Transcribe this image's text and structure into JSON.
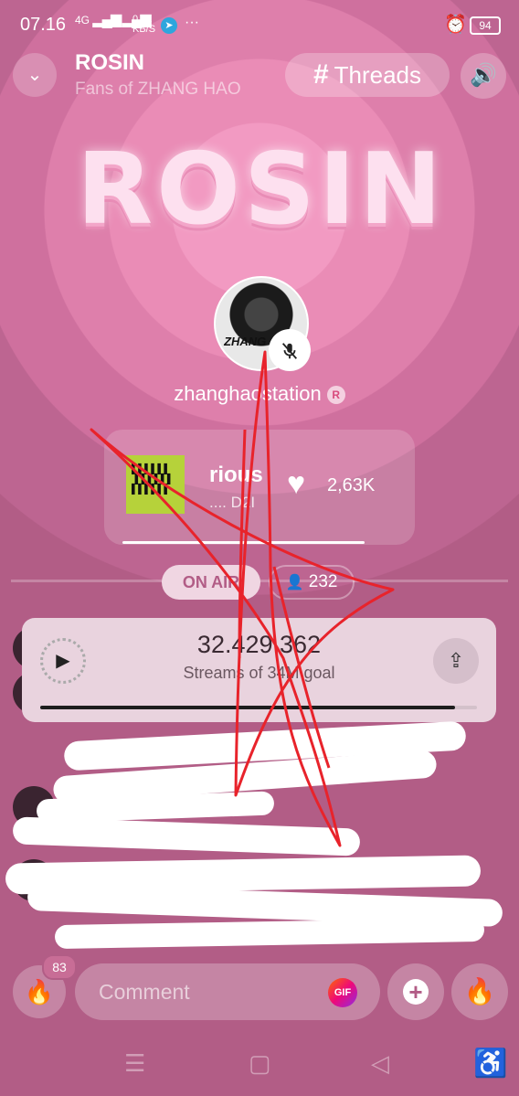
{
  "status_bar": {
    "time": "07.16",
    "network": "4G",
    "speed_value": "0.21",
    "speed_unit": "KB/S",
    "dots": "···",
    "battery": "94"
  },
  "header": {
    "title": "ROSIN",
    "subtitle": "Fans of ZHANG HAO",
    "threads_label": "Threads"
  },
  "logo_text": "ROSIN",
  "host": {
    "avatar_text": "ZHANG STAT",
    "name": "zhanghaostation",
    "badge": "R"
  },
  "now_playing": {
    "title": "rious",
    "artist": ".... D2I",
    "likes": "2,63K",
    "progress": 0.78
  },
  "room": {
    "on_air_label": "ON AIR",
    "listeners": "232"
  },
  "streams": {
    "count": "32.429.362",
    "goal_label": "Streams of 34M goal",
    "progress": 0.95
  },
  "bottom": {
    "fire_count": "83",
    "comment_placeholder": "Comment",
    "gif_label": "GIF"
  },
  "icons": {
    "back": "chevron-down-icon",
    "speaker": "speaker-icon",
    "mute": "mic-off-icon",
    "like": "heart-icon",
    "listeners": "person-icon",
    "play": "play-icon",
    "share": "share-icon",
    "fire": "fire-icon",
    "add": "plus-icon",
    "accessibility": "accessibility-icon"
  },
  "colors": {
    "background": "#b25d86",
    "annotation": "#e8232b",
    "on_air_text": "#b25d86"
  }
}
